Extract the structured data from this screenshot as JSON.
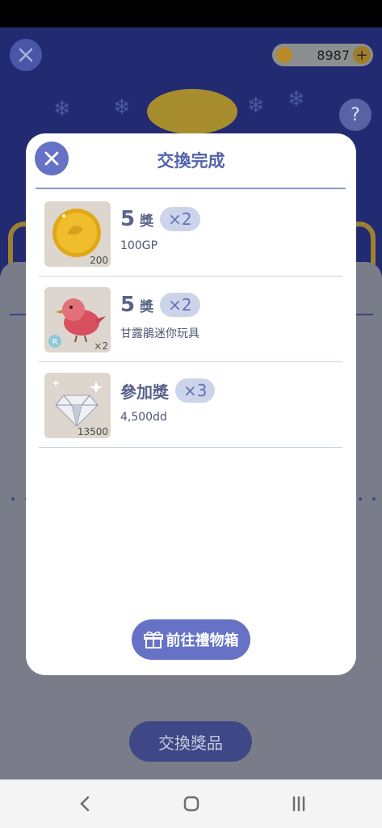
{
  "background": {
    "coin_balance": "8987",
    "exchange_button_label": "交換獎品",
    "help_label": "?"
  },
  "modal": {
    "title": "交換完成",
    "prizes": [
      {
        "tier_number": "5",
        "tier_unit": "獎",
        "quantity": "×2",
        "description": "100GP",
        "thumb_badge": "200",
        "icon": "gold-coin-icon"
      },
      {
        "tier_number": "5",
        "tier_unit": "獎",
        "quantity": "×2",
        "description": "甘露鵑迷你玩具",
        "thumb_badge": "×2",
        "rarity": "R",
        "icon": "red-bird-toy-icon"
      },
      {
        "tier_label": "參加獎",
        "quantity": "×3",
        "description": "4,500dd",
        "thumb_badge": "13500",
        "icon": "diamond-icon"
      }
    ],
    "cta_label": "前往禮物箱"
  },
  "colors": {
    "accent": "#6672c6",
    "title": "#5262ab",
    "quantity_pill": "#ccd4ea"
  }
}
